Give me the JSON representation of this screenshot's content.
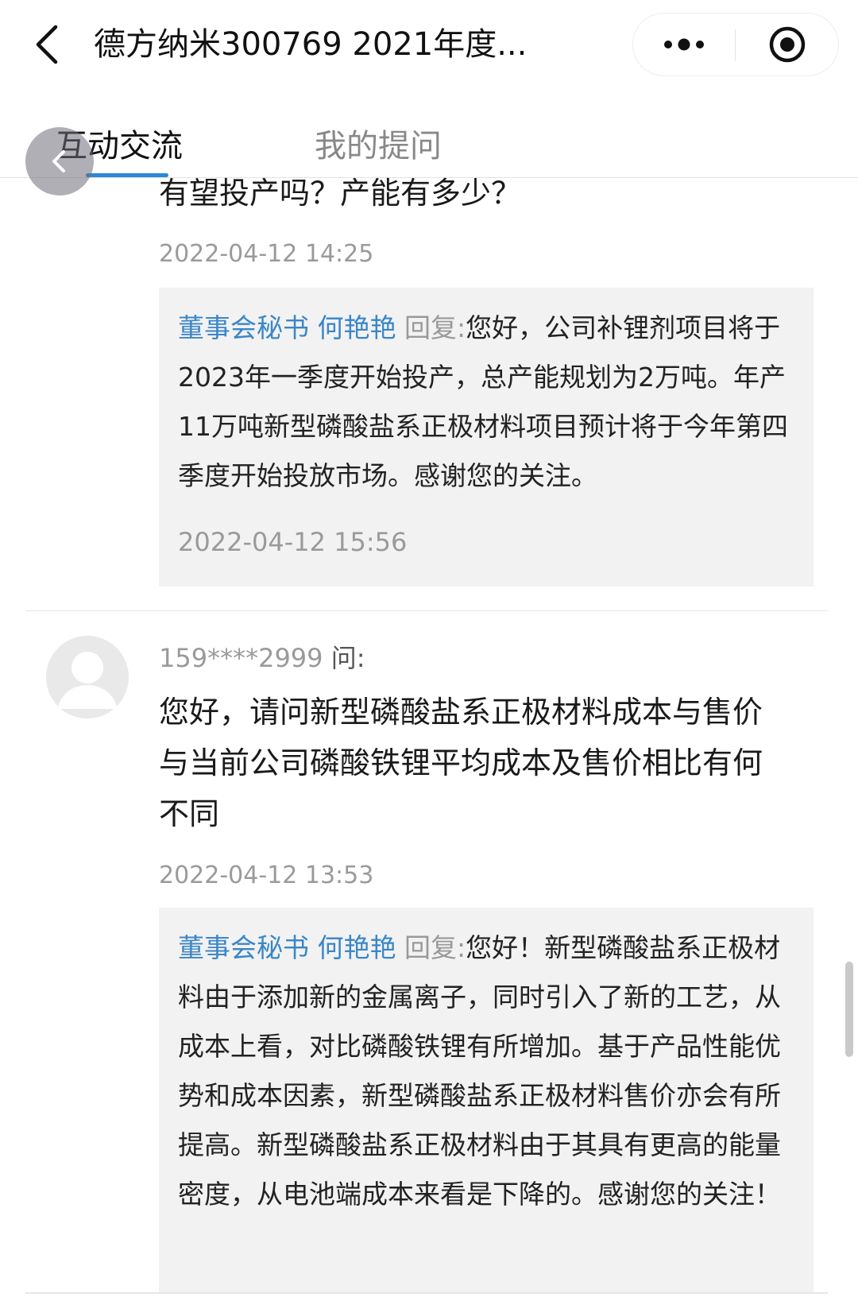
{
  "titlebar": {
    "title": "德方纳米300769 2021年度...",
    "back_icon": "chevron-left-icon",
    "more_icon": "more-dots-icon",
    "close_icon": "target-circle-icon"
  },
  "tabs": [
    {
      "label": "互动交流",
      "active": true
    },
    {
      "label": "我的提问",
      "active": false
    }
  ],
  "accent_color": "#2b88d8",
  "role_color": "#3a86c8",
  "posts": [
    {
      "question_tail": "有望投产吗？产能有多少？",
      "question_time": "2022-04-12 14:25",
      "reply": {
        "role": "董事会秘书 何艳艳",
        "reply_label": "回复:",
        "text": "您好，公司补锂剂项目将于2023年一季度开始投产，总产能规划为2万吨。年产11万吨新型磷酸盐系正极材料项目预计将于今年第四季度开始投放市场。感谢您的关注。",
        "time": "2022-04-12 15:56"
      }
    },
    {
      "asker": "159****2999",
      "ask_label": "问:",
      "question": "您好，请问新型磷酸盐系正极材料成本与售价与当前公司磷酸铁锂平均成本及售价相比有何不同",
      "question_time": "2022-04-12 13:53",
      "reply": {
        "role": "董事会秘书 何艳艳",
        "reply_label": "回复:",
        "text": "您好！新型磷酸盐系正极材料由于添加新的金属离子，同时引入了新的工艺，从成本上看，对比磷酸铁锂有所增加。基于产品性能优势和成本因素，新型磷酸盐系正极材料售价亦会有所提高。新型磷酸盐系正极材料由于其具有更高的能量密度，从电池端成本来看是下降的。感谢您的关注！"
      }
    }
  ]
}
